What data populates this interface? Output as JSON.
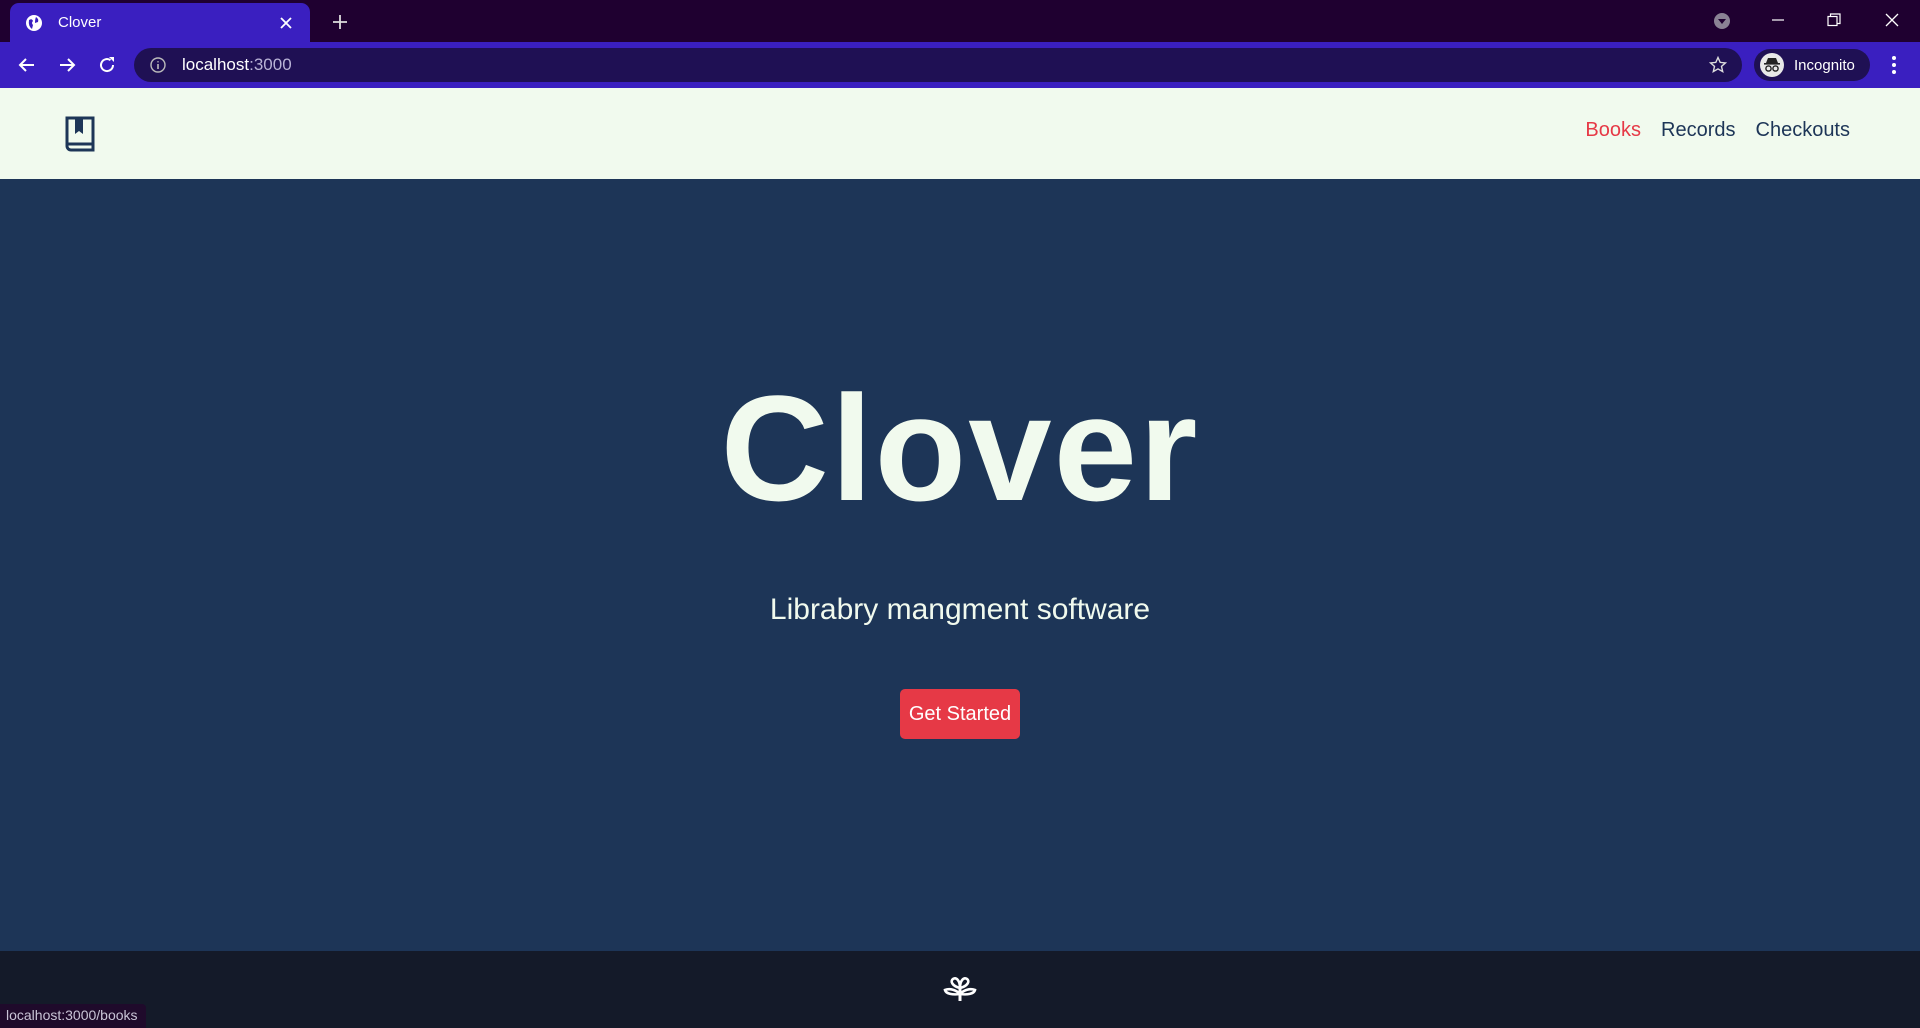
{
  "browser": {
    "tab": {
      "title": "Clover",
      "favicon": "globe-icon"
    },
    "url": {
      "host": "localhost",
      "port": ":3000"
    },
    "profile_label": "Incognito",
    "status_url": "localhost:3000/books"
  },
  "site": {
    "logo": "book-icon",
    "nav": [
      {
        "label": "Books",
        "active": true
      },
      {
        "label": "Records",
        "active": false
      },
      {
        "label": "Checkouts",
        "active": false
      }
    ]
  },
  "hero": {
    "title": "Clover",
    "subtitle": "Librabry mangment software",
    "cta_label": "Get Started"
  },
  "footer": {
    "icon": "sprout-icon"
  },
  "colors": {
    "navy": "#1d3557",
    "cream": "#f1faee",
    "red": "#e63946",
    "footer_bg": "#141a29",
    "chrome_tab": "#3a1fc0",
    "chrome_frame": "#1f0030"
  }
}
